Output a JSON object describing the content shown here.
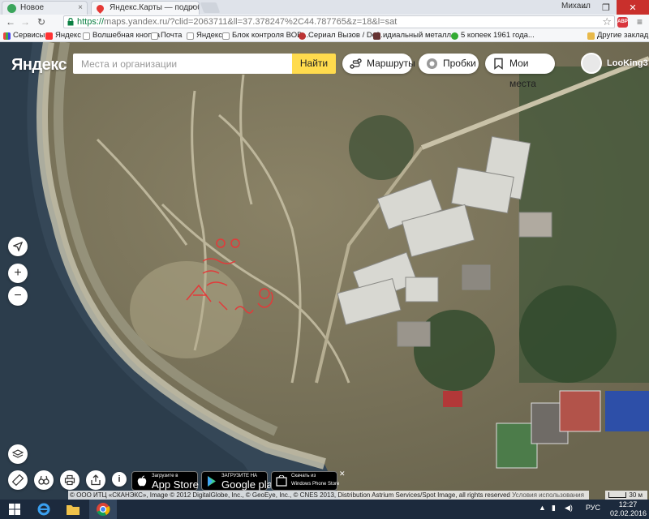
{
  "browser": {
    "tabs": [
      {
        "title": "Новое"
      },
      {
        "title": "Яндекс.Карты — подробн"
      }
    ],
    "window_user": "Михаил",
    "url_secure": "https://",
    "url_rest": "maps.yandex.ru/?clid=2063711&ll=37.378247%2C44.787765&z=18&l=sat",
    "bookmarks": [
      {
        "label": "Сервисы"
      },
      {
        "label": "Яндекс"
      },
      {
        "label": "Волшебная кнопка"
      },
      {
        "label": "Почта"
      },
      {
        "label": "Яндекс"
      },
      {
        "label": "Блок контроля ВОВ..."
      },
      {
        "label": "Сериал Вызов / Def..."
      },
      {
        "label": "идиальный металл..."
      },
      {
        "label": "5 копеек 1961 года..."
      }
    ],
    "other_bookmarks": "Другие закладки"
  },
  "map": {
    "logo": "Яндекс",
    "search_placeholder": "Места и организации",
    "search_button": "Найти",
    "routes_label": "Маршруты",
    "traffic_label": "Пробки",
    "my_places_label": "Мои места",
    "username": "LooKing3",
    "zoom_in": "+",
    "zoom_out": "−",
    "info": "i",
    "badges": {
      "appstore_small": "Загрузите в",
      "appstore_big": "App Store",
      "google_small": "ЗАГРУЗИТЕ НА",
      "google_big": "Google play",
      "windows_small": "Скачать из",
      "windows_big": "Windows Phone Store"
    },
    "copyright": "© ООО ИТЦ «СКАНЭКС», Image © 2012 DigitalGlobe, Inc., © GeoEye, Inc., © CNES 2013, Distribution Astrium Services/Spot Image, all rights reserved",
    "terms": "Условия использования",
    "scale": "30 м"
  },
  "taskbar": {
    "lang": "РУС",
    "time": "12:27",
    "date": "02.02.2016"
  },
  "colors": {
    "yandex_yellow": "#ffdb4d",
    "secure_green": "#0b8043",
    "taskbar": "#1c2a3d"
  }
}
